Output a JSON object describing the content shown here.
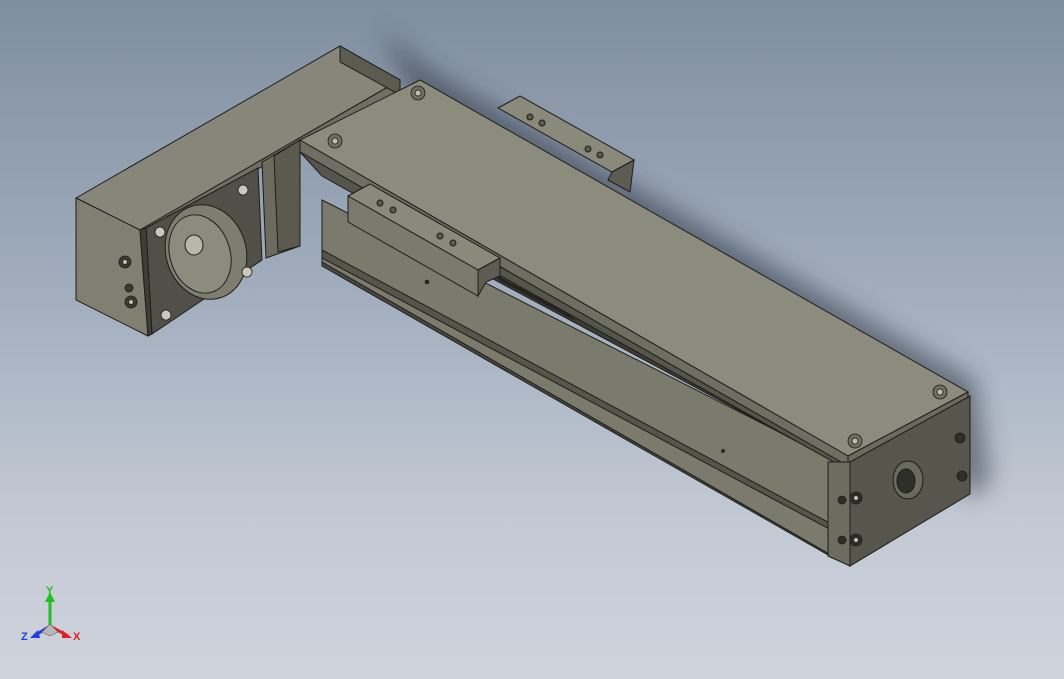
{
  "viewport": {
    "background_top": "#7f8ea0",
    "background_bottom": "#cfd3dc",
    "part_colors": {
      "top_face": "#8a8a7c",
      "front_face": "#7c7c6e",
      "side_face": "#6a6a5e",
      "dark_face": "#4e4e45",
      "edge": "#1e1e1a"
    }
  },
  "triad": {
    "x_label": "X",
    "y_label": "Y",
    "z_label": "Z",
    "x_color": "#e02020",
    "y_color": "#20c020",
    "z_color": "#2040e0"
  }
}
